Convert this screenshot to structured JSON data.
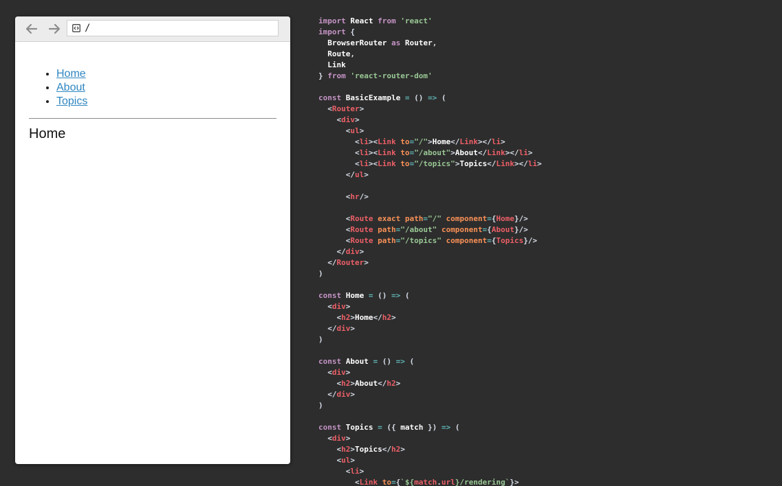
{
  "browser": {
    "url": "/",
    "nav_links": [
      "Home",
      "About",
      "Topics"
    ],
    "heading": "Home"
  },
  "colors": {
    "page_background": "#2d2d2d",
    "link": "#2f86c0",
    "keyword": "#c594c5",
    "string": "#99c794",
    "tag": "#ec5f67",
    "operator": "#5fb3b3"
  },
  "icons": {
    "back": "arrow-left-icon",
    "forward": "arrow-right-icon",
    "url": "code-file-icon"
  },
  "code": [
    [
      [
        "kw",
        "import "
      ],
      [
        "",
        "React "
      ],
      [
        "kw",
        "from "
      ],
      [
        "str",
        "'react'"
      ]
    ],
    [
      [
        "kw",
        "import "
      ],
      [
        "p",
        "{"
      ]
    ],
    [
      [
        "",
        "  BrowserRouter "
      ],
      [
        "kw",
        "as "
      ],
      [
        "",
        "Router"
      ],
      [
        "p",
        ","
      ]
    ],
    [
      [
        "",
        "  Route"
      ],
      [
        "p",
        ","
      ]
    ],
    [
      [
        "",
        "  Link"
      ]
    ],
    [
      [
        "p",
        "} "
      ],
      [
        "kw",
        "from "
      ],
      [
        "str",
        "'react-router-dom'"
      ]
    ],
    [],
    [
      [
        "kw",
        "const "
      ],
      [
        "",
        "BasicExample "
      ],
      [
        "op",
        "= "
      ],
      [
        "p",
        "() "
      ],
      [
        "op",
        "=> "
      ],
      [
        "p",
        "("
      ]
    ],
    [
      [
        "p",
        "  <"
      ],
      [
        "tag",
        "Router"
      ],
      [
        "p",
        ">"
      ]
    ],
    [
      [
        "p",
        "    <"
      ],
      [
        "tag",
        "div"
      ],
      [
        "p",
        ">"
      ]
    ],
    [
      [
        "p",
        "      <"
      ],
      [
        "tag",
        "ul"
      ],
      [
        "p",
        ">"
      ]
    ],
    [
      [
        "p",
        "        <"
      ],
      [
        "tag",
        "li"
      ],
      [
        "p",
        "><"
      ],
      [
        "tag",
        "Link "
      ],
      [
        "attr",
        "to"
      ],
      [
        "op",
        "="
      ],
      [
        "str",
        "\"/\""
      ],
      [
        "p",
        ">"
      ],
      [
        "",
        "Home"
      ],
      [
        "p",
        "</"
      ],
      [
        "tag",
        "Link"
      ],
      [
        "p",
        "></"
      ],
      [
        "tag",
        "li"
      ],
      [
        "p",
        ">"
      ]
    ],
    [
      [
        "p",
        "        <"
      ],
      [
        "tag",
        "li"
      ],
      [
        "p",
        "><"
      ],
      [
        "tag",
        "Link "
      ],
      [
        "attr",
        "to"
      ],
      [
        "op",
        "="
      ],
      [
        "str",
        "\"/about\""
      ],
      [
        "p",
        ">"
      ],
      [
        "",
        "About"
      ],
      [
        "p",
        "</"
      ],
      [
        "tag",
        "Link"
      ],
      [
        "p",
        "></"
      ],
      [
        "tag",
        "li"
      ],
      [
        "p",
        ">"
      ]
    ],
    [
      [
        "p",
        "        <"
      ],
      [
        "tag",
        "li"
      ],
      [
        "p",
        "><"
      ],
      [
        "tag",
        "Link "
      ],
      [
        "attr",
        "to"
      ],
      [
        "op",
        "="
      ],
      [
        "str",
        "\"/topics\""
      ],
      [
        "p",
        ">"
      ],
      [
        "",
        "Topics"
      ],
      [
        "p",
        "</"
      ],
      [
        "tag",
        "Link"
      ],
      [
        "p",
        "></"
      ],
      [
        "tag",
        "li"
      ],
      [
        "p",
        ">"
      ]
    ],
    [
      [
        "p",
        "      </"
      ],
      [
        "tag",
        "ul"
      ],
      [
        "p",
        ">"
      ]
    ],
    [],
    [
      [
        "p",
        "      <"
      ],
      [
        "tag",
        "hr"
      ],
      [
        "p",
        "/>"
      ]
    ],
    [],
    [
      [
        "p",
        "      <"
      ],
      [
        "tag",
        "Route "
      ],
      [
        "attr",
        "exact "
      ],
      [
        "attr",
        "path"
      ],
      [
        "op",
        "="
      ],
      [
        "str",
        "\"/\" "
      ],
      [
        "attr",
        "component"
      ],
      [
        "op",
        "="
      ],
      [
        "p",
        "{"
      ],
      [
        "tag",
        "Home"
      ],
      [
        "p",
        "}/>"
      ]
    ],
    [
      [
        "p",
        "      <"
      ],
      [
        "tag",
        "Route "
      ],
      [
        "attr",
        "path"
      ],
      [
        "op",
        "="
      ],
      [
        "str",
        "\"/about\" "
      ],
      [
        "attr",
        "component"
      ],
      [
        "op",
        "="
      ],
      [
        "p",
        "{"
      ],
      [
        "tag",
        "About"
      ],
      [
        "p",
        "}/>"
      ]
    ],
    [
      [
        "p",
        "      <"
      ],
      [
        "tag",
        "Route "
      ],
      [
        "attr",
        "path"
      ],
      [
        "op",
        "="
      ],
      [
        "str",
        "\"/topics\" "
      ],
      [
        "attr",
        "component"
      ],
      [
        "op",
        "="
      ],
      [
        "p",
        "{"
      ],
      [
        "tag",
        "Topics"
      ],
      [
        "p",
        "}/>"
      ]
    ],
    [
      [
        "p",
        "    </"
      ],
      [
        "tag",
        "div"
      ],
      [
        "p",
        ">"
      ]
    ],
    [
      [
        "p",
        "  </"
      ],
      [
        "tag",
        "Router"
      ],
      [
        "p",
        ">"
      ]
    ],
    [
      [
        "p",
        ")"
      ]
    ],
    [],
    [
      [
        "kw",
        "const "
      ],
      [
        "",
        "Home "
      ],
      [
        "op",
        "= "
      ],
      [
        "p",
        "() "
      ],
      [
        "op",
        "=> "
      ],
      [
        "p",
        "("
      ]
    ],
    [
      [
        "p",
        "  <"
      ],
      [
        "tag",
        "div"
      ],
      [
        "p",
        ">"
      ]
    ],
    [
      [
        "p",
        "    <"
      ],
      [
        "tag",
        "h2"
      ],
      [
        "p",
        ">"
      ],
      [
        "",
        "Home"
      ],
      [
        "p",
        "</"
      ],
      [
        "tag",
        "h2"
      ],
      [
        "p",
        ">"
      ]
    ],
    [
      [
        "p",
        "  </"
      ],
      [
        "tag",
        "div"
      ],
      [
        "p",
        ">"
      ]
    ],
    [
      [
        "p",
        ")"
      ]
    ],
    [],
    [
      [
        "kw",
        "const "
      ],
      [
        "",
        "About "
      ],
      [
        "op",
        "= "
      ],
      [
        "p",
        "() "
      ],
      [
        "op",
        "=> "
      ],
      [
        "p",
        "("
      ]
    ],
    [
      [
        "p",
        "  <"
      ],
      [
        "tag",
        "div"
      ],
      [
        "p",
        ">"
      ]
    ],
    [
      [
        "p",
        "    <"
      ],
      [
        "tag",
        "h2"
      ],
      [
        "p",
        ">"
      ],
      [
        "",
        "About"
      ],
      [
        "p",
        "</"
      ],
      [
        "tag",
        "h2"
      ],
      [
        "p",
        ">"
      ]
    ],
    [
      [
        "p",
        "  </"
      ],
      [
        "tag",
        "div"
      ],
      [
        "p",
        ">"
      ]
    ],
    [
      [
        "p",
        ")"
      ]
    ],
    [],
    [
      [
        "kw",
        "const "
      ],
      [
        "",
        "Topics "
      ],
      [
        "op",
        "= "
      ],
      [
        "p",
        "({ "
      ],
      [
        "",
        "match "
      ],
      [
        "p",
        "}) "
      ],
      [
        "op",
        "=> "
      ],
      [
        "p",
        "("
      ]
    ],
    [
      [
        "p",
        "  <"
      ],
      [
        "tag",
        "div"
      ],
      [
        "p",
        ">"
      ]
    ],
    [
      [
        "p",
        "    <"
      ],
      [
        "tag",
        "h2"
      ],
      [
        "p",
        ">"
      ],
      [
        "",
        "Topics"
      ],
      [
        "p",
        "</"
      ],
      [
        "tag",
        "h2"
      ],
      [
        "p",
        ">"
      ]
    ],
    [
      [
        "p",
        "    <"
      ],
      [
        "tag",
        "ul"
      ],
      [
        "p",
        ">"
      ]
    ],
    [
      [
        "p",
        "      <"
      ],
      [
        "tag",
        "li"
      ],
      [
        "p",
        ">"
      ]
    ],
    [
      [
        "p",
        "        <"
      ],
      [
        "tag",
        "Link "
      ],
      [
        "attr",
        "to"
      ],
      [
        "op",
        "="
      ],
      [
        "p",
        "{"
      ],
      [
        "str",
        "`${"
      ],
      [
        "tag",
        "match"
      ],
      [
        "p",
        "."
      ],
      [
        "tag",
        "url"
      ],
      [
        "str",
        "}/rendering`"
      ],
      [
        "p",
        "}>"
      ]
    ]
  ]
}
